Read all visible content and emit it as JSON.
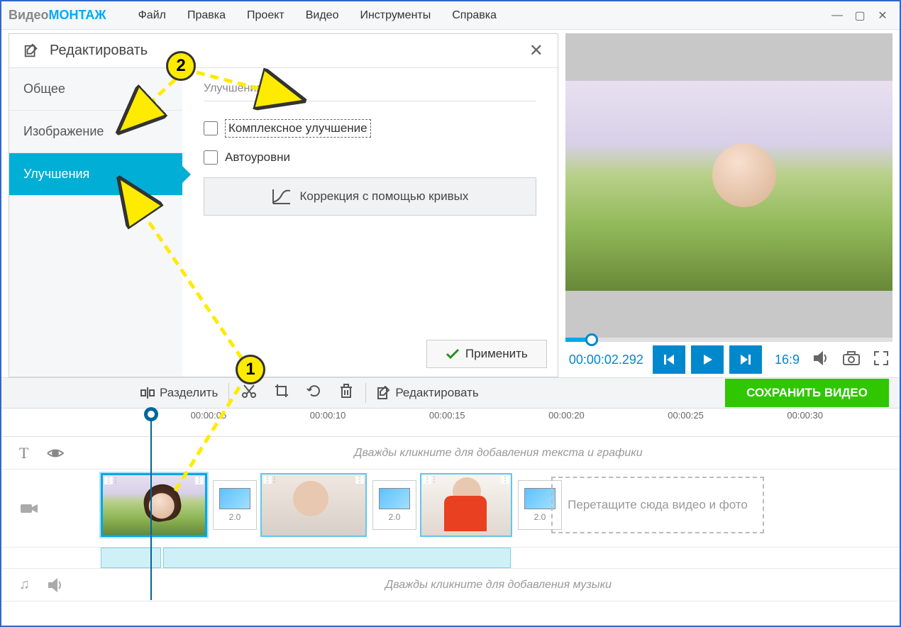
{
  "app": {
    "name1": "Видео",
    "name2": "МОНТАЖ"
  },
  "menu": [
    "Файл",
    "Правка",
    "Проект",
    "Видео",
    "Инструменты",
    "Справка"
  ],
  "panel": {
    "title": "Редактировать",
    "tabs": {
      "general": "Общее",
      "image": "Изображение",
      "enhance": "Улучшения"
    },
    "section": "Улучшения",
    "cb1": "Комплексное улучшение",
    "cb2": "Автоуровни",
    "curves": "Коррекция с помощью кривых",
    "apply": "Применить"
  },
  "preview": {
    "time": "00:00:02.292",
    "ratio": "16:9"
  },
  "toolbar": {
    "split": "Разделить",
    "edit": "Редактировать",
    "save": "СОХРАНИТЬ ВИДЕО"
  },
  "ruler": [
    "00:00:05",
    "00:00:10",
    "00:00:15",
    "00:00:20",
    "00:00:25",
    "00:00:30"
  ],
  "hints": {
    "text_track": "Дважды кликните для добавления текста и графики",
    "music_track": "Дважды кликните для добавления музыки",
    "drop": "Перетащите сюда видео и фото"
  },
  "transitions": [
    "2.0",
    "2.0",
    "2.0"
  ],
  "annotations": {
    "b1": "1",
    "b2": "2"
  }
}
